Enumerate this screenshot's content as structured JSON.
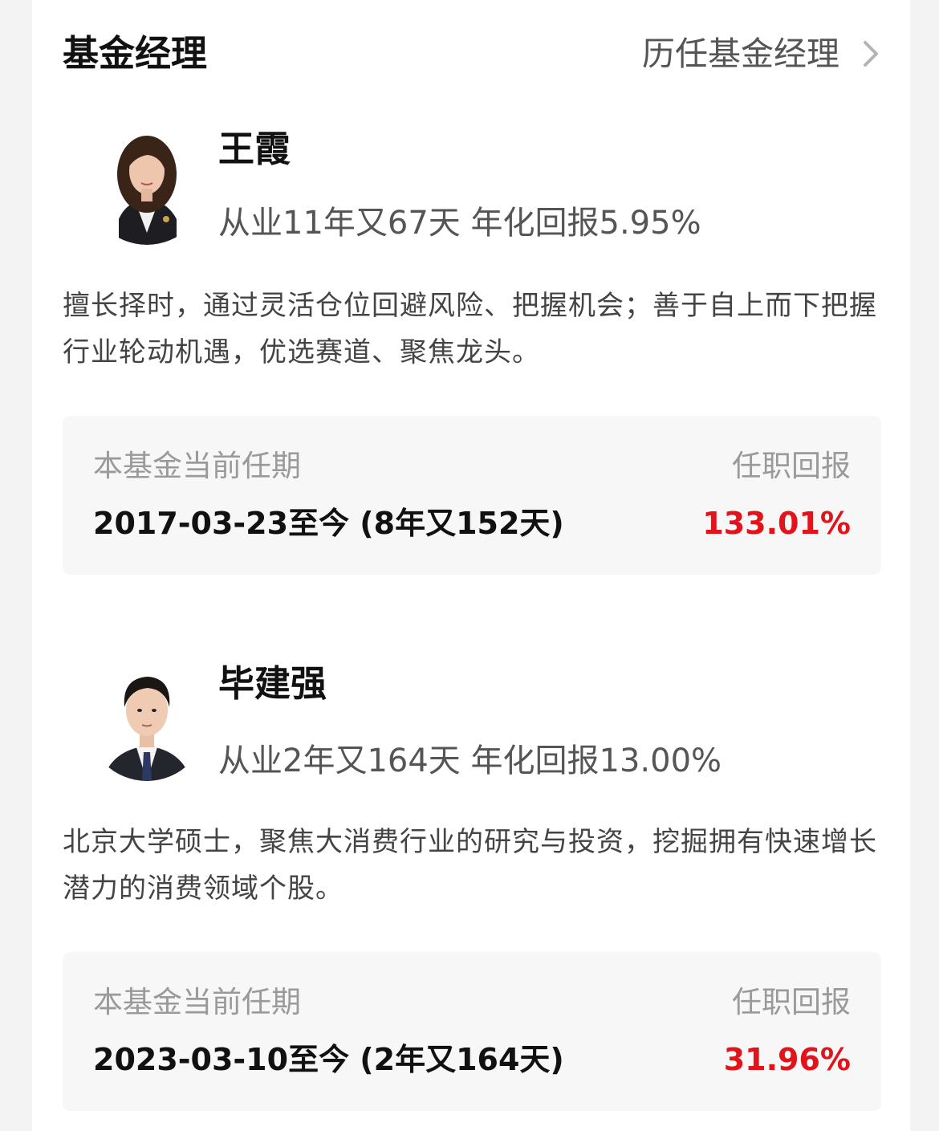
{
  "header": {
    "title": "基金经理",
    "history_link": "历任基金经理",
    "history_icon": "chevron-right-icon"
  },
  "managers": [
    {
      "name": "王霞",
      "stats": "从业11年又67天 年化回报5.95%",
      "description": "擅长择时，通过灵活仓位回避风险、把握机会；善于自上而下把握行业轮动机遇，优选赛道、聚焦龙头。",
      "tenure_label": "本基金当前任期",
      "tenure_value": "2017-03-23至今 (8年又152天)",
      "return_label": "任职回报",
      "return_value": "133.01%"
    },
    {
      "name": "毕建强",
      "stats": "从业2年又164天 年化回报13.00%",
      "description": "北京大学硕士，聚焦大消费行业的研究与投资，挖掘拥有快速增长潜力的消费领域个股。",
      "tenure_label": "本基金当前任期",
      "tenure_value": "2023-03-10至今 (2年又164天)",
      "return_label": "任职回报",
      "return_value": "31.96%"
    }
  ],
  "colors": {
    "return_positive": "#e0141a",
    "tenure_box_bg": "#f7f7f7"
  }
}
